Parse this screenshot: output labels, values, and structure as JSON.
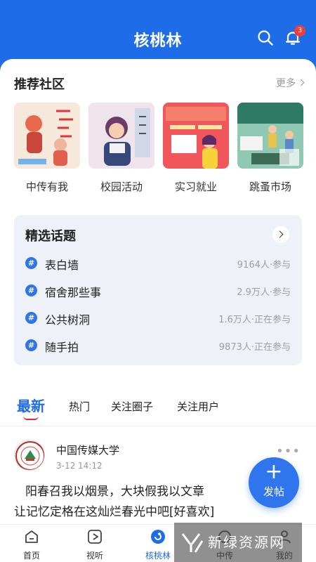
{
  "header": {
    "title": "核桃林",
    "notification_count": "3"
  },
  "recommended": {
    "title": "推荐社区",
    "more_label": "更多",
    "items": [
      {
        "label": "中传有我"
      },
      {
        "label": "校园活动"
      },
      {
        "label": "实习就业"
      },
      {
        "label": "跳蚤市场"
      }
    ]
  },
  "topics": {
    "title": "精选话题",
    "items": [
      {
        "name": "表白墙",
        "meta": "9164人·参与"
      },
      {
        "name": "宿舍那些事",
        "meta": "2.9万人·参与"
      },
      {
        "name": "公共树洞",
        "meta": "1.6万人·正在参与"
      },
      {
        "name": "随手拍",
        "meta": "9873人·正在参与"
      }
    ]
  },
  "tabs": [
    "最新",
    "热门",
    "关注圈子",
    "关注用户"
  ],
  "post": {
    "author": "中国传媒大学",
    "time": "3-12 14:12",
    "line1": "阳春召我以烟景，大块假我以文章",
    "line2": "让记忆定格在这灿烂春光中吧[好喜欢]"
  },
  "fab_label": "发帖",
  "bottom_nav": [
    {
      "label": "首页"
    },
    {
      "label": "视听"
    },
    {
      "label": "核桃林"
    },
    {
      "label": "中传"
    },
    {
      "label": "我的"
    }
  ],
  "watermark": "新绿资源网",
  "colors": {
    "brand_blue": "#1f6ce8",
    "accent_red": "#e02b2b"
  }
}
